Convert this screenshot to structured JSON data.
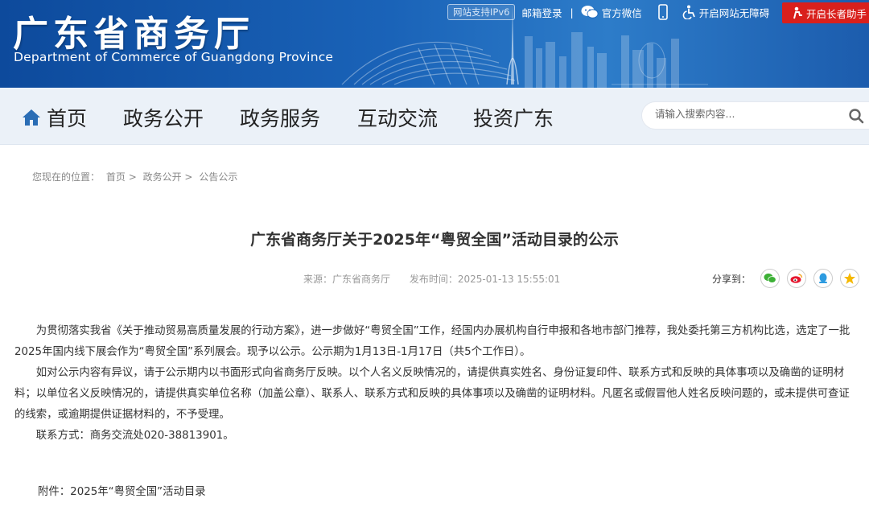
{
  "header": {
    "title": "广东省商务厅",
    "subtitle": "Department of Commerce of Guangdong Province",
    "ipv6_badge": "网站支持IPv6",
    "mail_login": "邮箱登录",
    "separator": "|",
    "wechat": "官方微信",
    "accessibility": "开启网站无障碍",
    "elder_helper": "开启长者助手"
  },
  "nav": {
    "items": [
      "首页",
      "政务公开",
      "政务服务",
      "互动交流",
      "投资广东"
    ],
    "search_placeholder": "请输入搜索内容..."
  },
  "breadcrumb": {
    "prefix": "您现在的位置：",
    "items": [
      "首页",
      "政务公开",
      "公告公示"
    ],
    "sep": ">"
  },
  "article": {
    "title": "广东省商务厅关于2025年“粤贸全国”活动目录的公示",
    "source": "来源：广东省商务厅",
    "published": "发布时间：2025-01-13 15:55:01",
    "share_label": "分享到：",
    "paragraphs": [
      "为贯彻落实我省《关于推动贸易高质量发展的行动方案》，进一步做好“粤贸全国”工作，经国内办展机构自行申报和各地市部门推荐，我处委托第三方机构比选，选定了一批2025年国内线下展会作为“粤贸全国”系列展会。现予以公示。公示期为1月13日-1月17日（共5个工作日）。",
      "如对公示内容有异议，请于公示期内以书面形式向省商务厅反映。以个人名义反映情况的，请提供真实姓名、身份证复印件、联系方式和反映的具体事项以及确凿的证明材料；以单位名义反映情况的，请提供真实单位名称（加盖公章）、联系人、联系方式和反映的具体事项以及确凿的证明材料。凡匿名或假冒他人姓名反映问题的，或未提供可查证的线索，或逾期提供证据材料的，不予受理。",
      "联系方式：商务交流处020-38813901。"
    ],
    "attachment": "附件：2025年“粤贸全国”活动目录"
  },
  "colors": {
    "banner": "#1a63b8",
    "nav_bg": "#ebf1f8",
    "elder_red": "#d9201c",
    "home_icon": "#2a6db5"
  },
  "icons": [
    "home-icon",
    "search-icon",
    "wechat-icon",
    "phone-icon",
    "accessibility-icon",
    "elder-icon",
    "share-wechat-icon",
    "share-weibo-icon",
    "share-qq-icon",
    "share-qzone-icon"
  ]
}
